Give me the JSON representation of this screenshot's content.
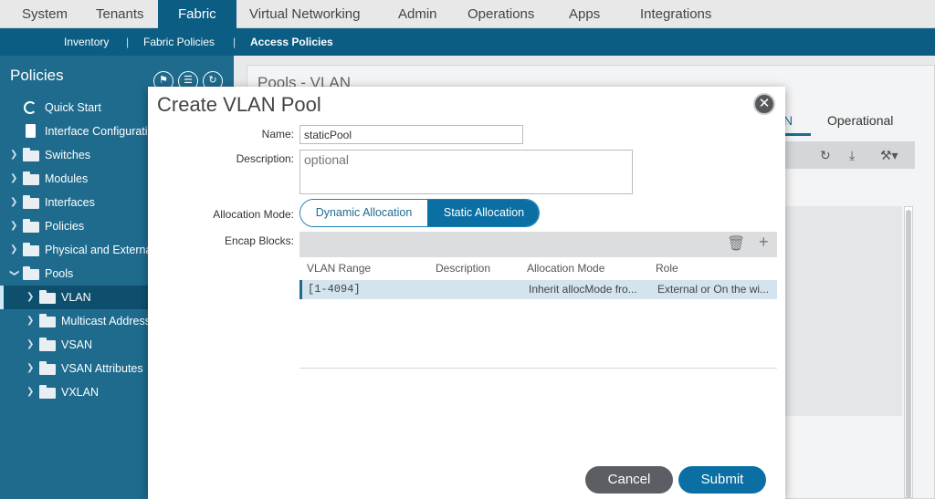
{
  "top_nav": {
    "tabs": [
      "System",
      "Tenants",
      "Fabric",
      "Virtual Networking",
      "Admin",
      "Operations",
      "Apps",
      "Integrations"
    ],
    "active": "Fabric"
  },
  "sub_nav": {
    "items": [
      "Inventory",
      "Fabric Policies",
      "Access Policies"
    ],
    "active": "Access Policies",
    "separator": "|"
  },
  "sidebar": {
    "title": "Policies",
    "tools": [
      "flag-icon",
      "list-icon",
      "refresh-icon"
    ],
    "items": [
      {
        "label": "Quick Start",
        "icon": "quickstart-icon"
      },
      {
        "label": "Interface Configuratio",
        "icon": "document-icon"
      },
      {
        "label": "Switches",
        "icon": "folder-icon"
      },
      {
        "label": "Modules",
        "icon": "folder-icon"
      },
      {
        "label": "Interfaces",
        "icon": "folder-icon"
      },
      {
        "label": "Policies",
        "icon": "folder-icon"
      },
      {
        "label": "Physical and Externa",
        "icon": "folder-icon"
      },
      {
        "label": "Pools",
        "icon": "folder-icon"
      },
      {
        "label": "VLAN",
        "icon": "folder-icon"
      },
      {
        "label": "Multicast Address",
        "icon": "folder-icon"
      },
      {
        "label": "VSAN",
        "icon": "folder-icon"
      },
      {
        "label": "VSAN Attributes",
        "icon": "folder-icon"
      },
      {
        "label": "VXLAN",
        "icon": "folder-icon"
      }
    ]
  },
  "background": {
    "page_title": "Pools - VLAN",
    "tab_partial": "N",
    "tab_operational": "Operational"
  },
  "modal": {
    "title": "Create VLAN Pool",
    "name_label": "Name:",
    "name_value": "staticPool",
    "description_label": "Description:",
    "description_placeholder": "optional",
    "allocation_label": "Allocation Mode:",
    "allocation_options": [
      "Dynamic Allocation",
      "Static Allocation"
    ],
    "allocation_selected": "Static Allocation",
    "encap_label": "Encap Blocks:",
    "columns": [
      "VLAN Range",
      "Description",
      "Allocation Mode",
      "Role"
    ],
    "rows": [
      {
        "vlan_range": "[1-4094]",
        "description": "",
        "allocation_mode": "Inherit allocMode fro...",
        "role": "External or On the wi..."
      }
    ],
    "cancel_label": "Cancel",
    "submit_label": "Submit"
  },
  "colors": {
    "brand": "#0b5d84",
    "sidebar": "#1e6b8e",
    "accent": "#0b6fa4",
    "cancel": "#5b5f63"
  }
}
